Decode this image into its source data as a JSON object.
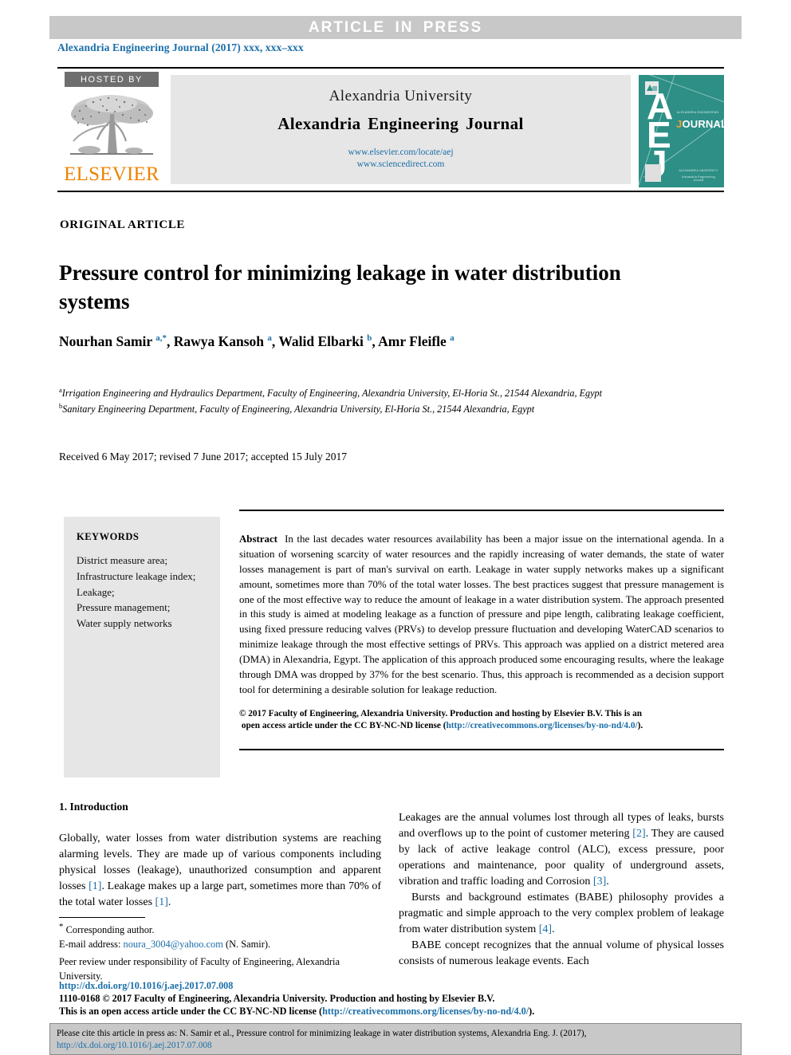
{
  "banner": {
    "article_in_press": "ARTICLE  IN  PRESS"
  },
  "journal_line": "Alexandria Engineering Journal (2017) xxx, xxx–xxx",
  "masthead": {
    "hosted_by": "HOSTED BY",
    "publisher": "ELSEVIER",
    "university": "Alexandria University",
    "journal_title": "Alexandria Engineering Journal",
    "url_elsevier": "www.elsevier.com/locate/aej",
    "url_sciencedirect": "www.sciencedirect.com",
    "cover": {
      "letters": "AEJ",
      "journal_word": "JOURNAL",
      "top_caption": "ALEXANDRIA ENGINEERING",
      "bottom_caption": "ALEXANDRIA UNIVERSITY",
      "bottom_caption2": "Alexandria Engineering Journal"
    }
  },
  "article": {
    "type": "ORIGINAL ARTICLE",
    "title": "Pressure control for minimizing leakage in water distribution systems",
    "authors_html": "Nourhan Samir <sup>a,*</sup>, Rawya Kansoh <sup>a</sup>, Walid Elbarki <sup>b</sup>, Amr Fleifle <sup>a</sup>",
    "affiliation_a": "Irrigation Engineering and Hydraulics Department, Faculty of Engineering, Alexandria University, El-Horia St., 21544 Alexandria, Egypt",
    "affiliation_b": "Sanitary Engineering Department, Faculty of Engineering, Alexandria University, El-Horia St., 21544 Alexandria, Egypt",
    "history": "Received 6 May 2017; revised 7 June 2017; accepted 15 July 2017"
  },
  "keywords": {
    "heading": "KEYWORDS",
    "items": [
      "District measure area;",
      "Infrastructure leakage index;",
      "Leakage;",
      "Pressure management;",
      "Water supply networks"
    ]
  },
  "abstract": {
    "label": "Abstract",
    "text": "In the last decades water resources availability has been a major issue on the international agenda. In a situation of worsening scarcity of water resources and the rapidly increasing of water demands, the state of water losses management is part of man's survival on earth. Leakage in water supply networks makes up a significant amount, sometimes more than 70% of the total water losses. The best practices suggest that pressure management is one of the most effective way to reduce the amount of leakage in a water distribution system. The approach presented in this study is aimed at modeling leakage as a function of pressure and pipe length, calibrating leakage coefficient, using fixed pressure reducing valves (PRVs) to develop pressure fluctuation and developing WaterCAD scenarios to minimize leakage through the most effective settings of PRVs. This approach was applied on a district metered area (DMA) in Alexandria, Egypt. The application of this approach produced some encouraging results, where the leakage through DMA was dropped by 37% for the best scenario. Thus, this approach is recommended as a decision support tool for determining a desirable solution for leakage reduction.",
    "copyright_line1": "© 2017 Faculty of Engineering, Alexandria University. Production and hosting by Elsevier B.V. This is an",
    "copyright_line2_pre": "open access article under the CC BY-NC-ND license (",
    "copyright_link": "http://creativecommons.org/licenses/by-no-nd/4.0/",
    "copyright_line2_post": ")."
  },
  "introduction": {
    "heading": "1. Introduction",
    "left_paragraph_1_pre": "Globally, water losses from water distribution systems are reaching alarming levels. They are made up of various components including physical losses (leakage), unauthorized consumption and apparent losses ",
    "ref_1a": "[1]",
    "left_paragraph_1_mid": ". Leakage makes up a large part, sometimes more than 70% of the total water losses ",
    "ref_1b": "[1]",
    "left_paragraph_1_post": ".",
    "right_paragraph_1_pre": "Leakages are the annual volumes lost through all types of leaks, bursts and overflows up to the point of customer metering ",
    "ref_2": "[2]",
    "right_paragraph_1_mid": ". They are caused by lack of active leakage control (ALC), excess pressure, poor operations and maintenance, poor quality of underground assets, vibration and traffic loading and Corrosion ",
    "ref_3": "[3]",
    "right_paragraph_1_post": ".",
    "right_paragraph_2_pre": "Bursts and background estimates (BABE) philosophy provides a pragmatic and simple approach to the very complex problem of leakage from water distribution system ",
    "ref_4": "[4]",
    "right_paragraph_2_post": ".",
    "right_paragraph_3": "BABE concept recognizes that the annual volume of physical losses consists of numerous leakage events. Each"
  },
  "footnote": {
    "corresponding": "Corresponding author.",
    "email_label": "E-mail address:",
    "email": "noura_3004@yahoo.com",
    "email_owner": "(N. Samir).",
    "peer_review": "Peer review under responsibility of Faculty of Engineering, Alexandria University."
  },
  "legal": {
    "doi": "http://dx.doi.org/10.1016/j.aej.2017.07.008",
    "line2": "1110-0168 © 2017 Faculty of Engineering, Alexandria University. Production and hosting by Elsevier B.V.",
    "line3_pre": "This is an open access article under the CC BY-NC-ND license (",
    "line3_link": "http://creativecommons.org/licenses/by-no-nd/4.0/",
    "line3_post": ")."
  },
  "cite_box": {
    "text_pre": "Please cite this article in press as: N. Samir et al., Pressure control for minimizing leakage in water distribution systems,  Alexandria Eng. J. (2017), ",
    "link": "http://dx.doi.org/10.1016/j.aej.2017.07.008"
  },
  "colors": {
    "link": "#1a6ea8",
    "banner_bg": "#c8c8c8",
    "elsevier_orange": "#ef8200",
    "keyword_bg": "#e6e6e6",
    "cover_teal": "#2d8f86"
  }
}
